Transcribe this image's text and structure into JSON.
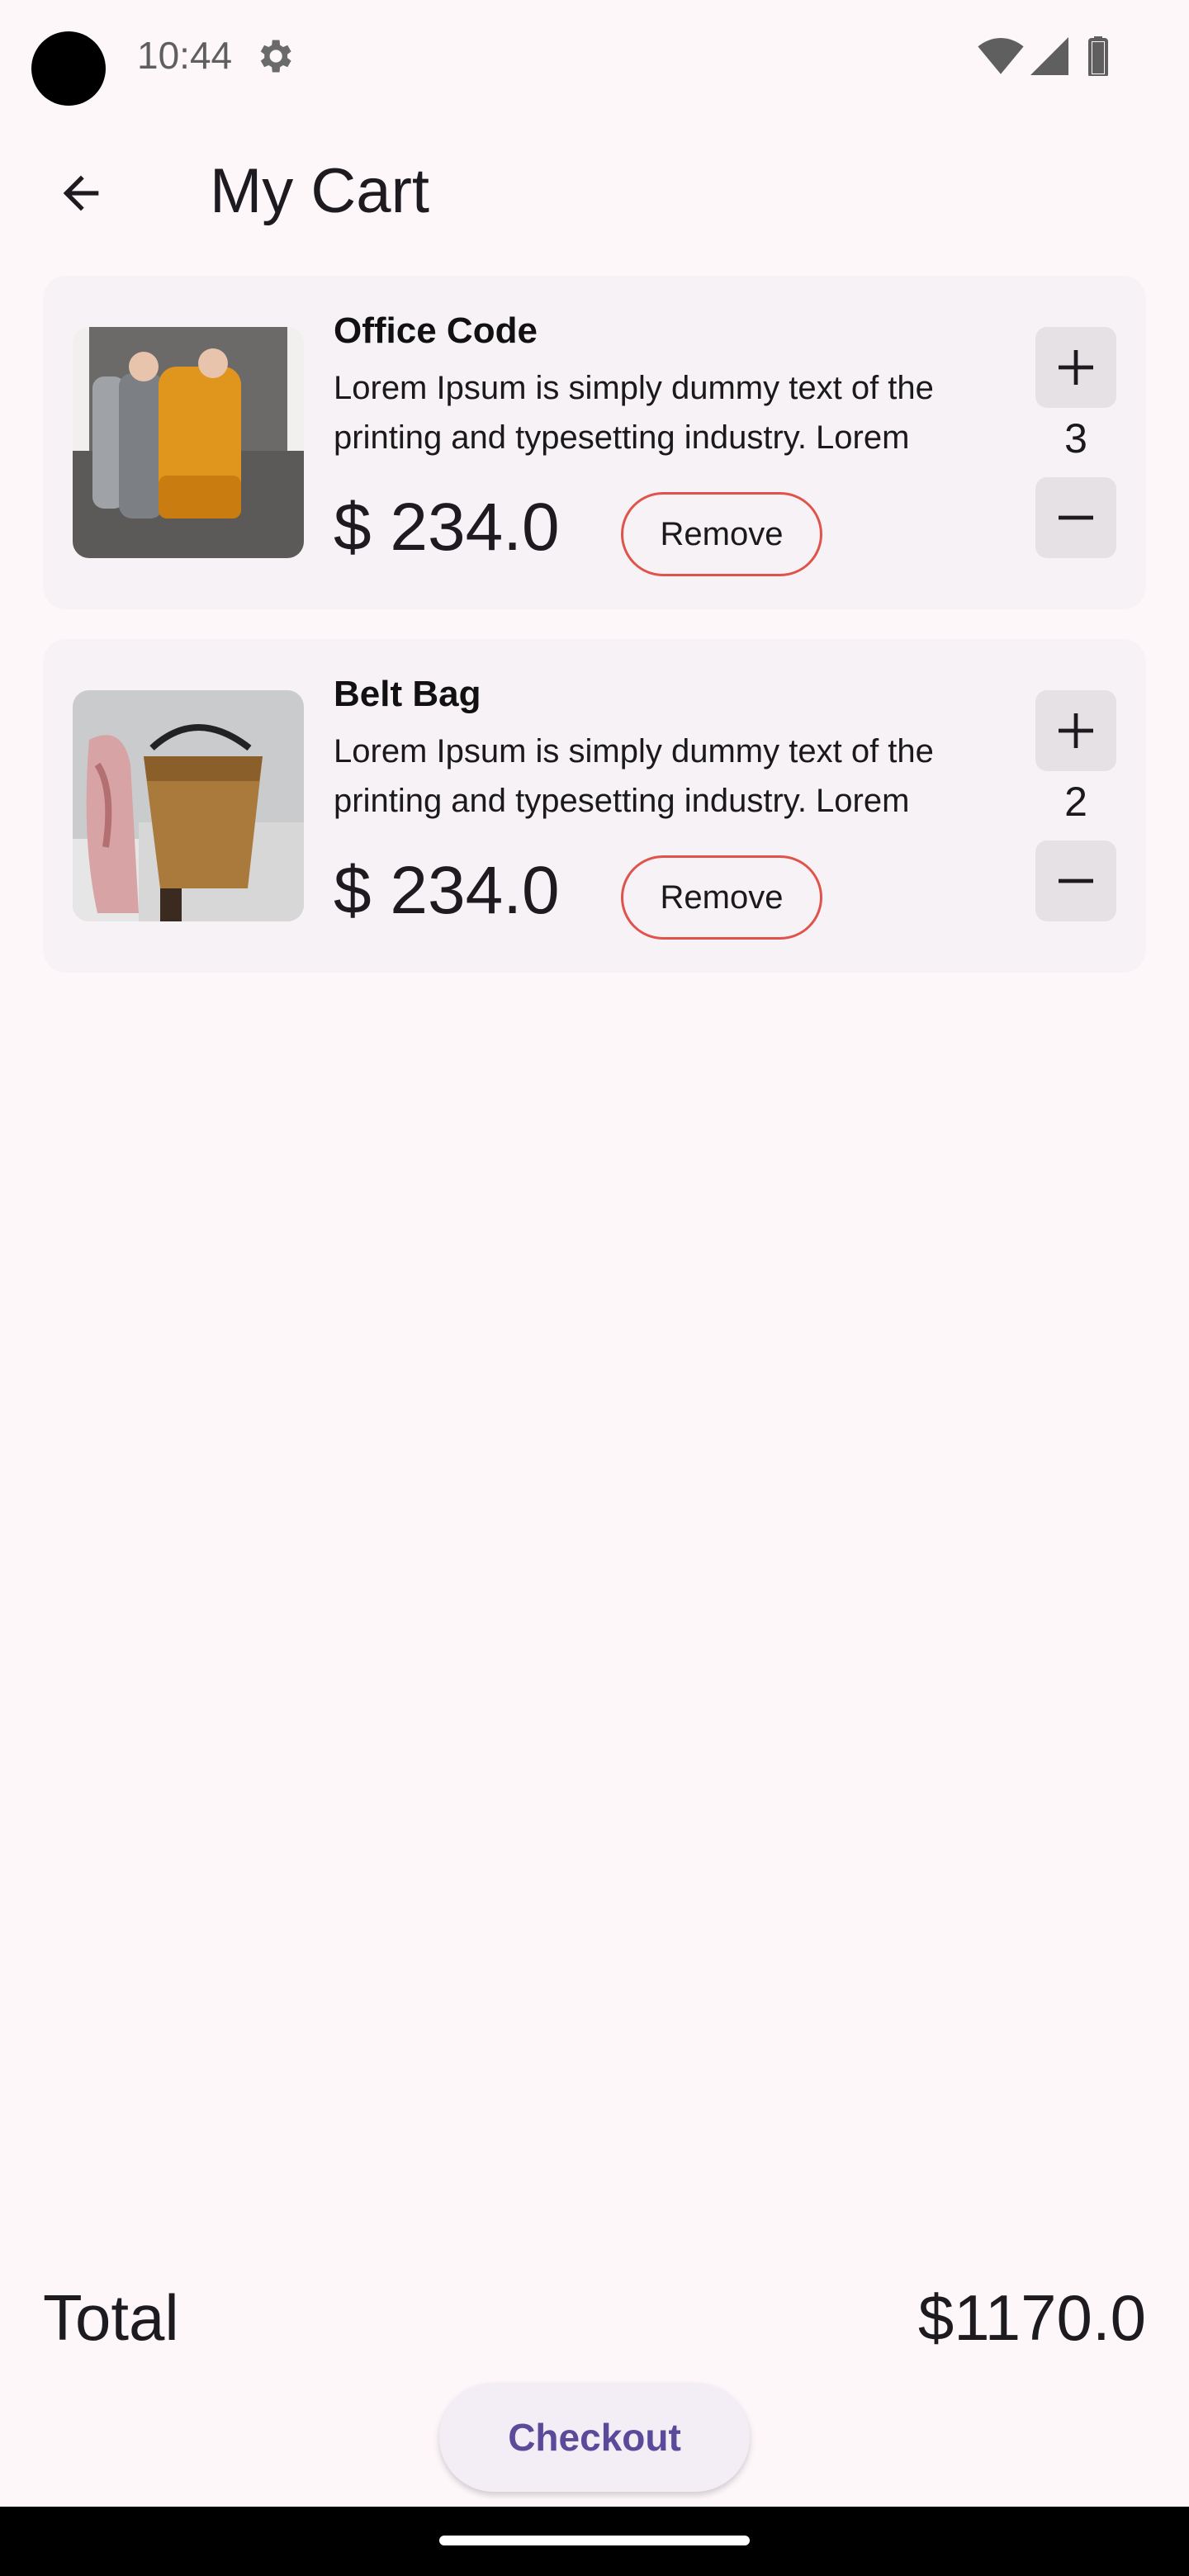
{
  "status_bar": {
    "time": "10:44",
    "icons": [
      "gear-icon",
      "wifi-icon",
      "signal-icon",
      "battery-icon"
    ]
  },
  "app_bar": {
    "title": "My Cart",
    "back_icon": "arrow-back-icon"
  },
  "cart": {
    "items": [
      {
        "name": "Office Code",
        "description": "Lorem Ipsum is simply dummy text of the printing and typesetting industry. Lorem",
        "price": "$ 234.0",
        "quantity": "3",
        "remove_label": "Remove",
        "image": "knit-beanies-photo"
      },
      {
        "name": "Belt Bag",
        "description": "Lorem Ipsum is simply dummy text of the printing and typesetting industry. Lorem",
        "price": "$ 234.0",
        "quantity": "2",
        "remove_label": "Remove",
        "image": "straw-bag-photo"
      }
    ]
  },
  "footer": {
    "total_label": "Total",
    "total_value": "$1170.0",
    "checkout_label": "Checkout"
  },
  "colors": {
    "background": "#fef7fa",
    "card": "#f7f2f5",
    "remove_border": "#e0534a",
    "checkout_text": "#5a4a9a"
  }
}
